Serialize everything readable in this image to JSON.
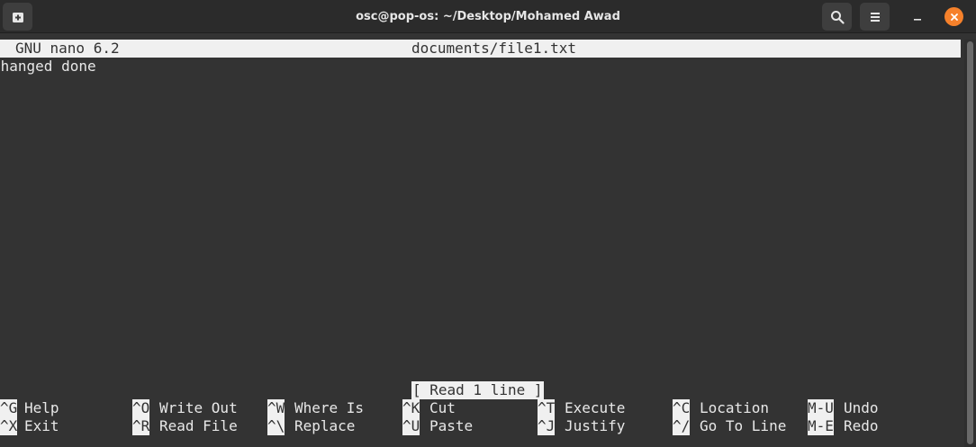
{
  "window": {
    "title": "osc@pop-os: ~/Desktop/Mohamed Awad"
  },
  "titlebar_icons": {
    "new_tab": "new-tab-icon",
    "search": "search-icon",
    "menu": "hamburger-menu-icon",
    "minimize": "minimize-icon",
    "close": "close-icon",
    "close_color": "#f6812b"
  },
  "nano": {
    "version": "GNU nano 6.2",
    "filename": "documents/file1.txt",
    "content": [
      "changed done"
    ],
    "status": "[ Read 1 line ]"
  },
  "shortcuts": [
    {
      "key": "^G",
      "label": "Help"
    },
    {
      "key": "^O",
      "label": "Write Out"
    },
    {
      "key": "^W",
      "label": "Where Is"
    },
    {
      "key": "^K",
      "label": "Cut"
    },
    {
      "key": "^T",
      "label": "Execute"
    },
    {
      "key": "^C",
      "label": "Location"
    },
    {
      "key": "M-U",
      "label": "Undo"
    },
    {
      "key": "^X",
      "label": "Exit"
    },
    {
      "key": "^R",
      "label": "Read File"
    },
    {
      "key": "^\\",
      "label": "Replace"
    },
    {
      "key": "^U",
      "label": "Paste"
    },
    {
      "key": "^J",
      "label": "Justify"
    },
    {
      "key": "^/",
      "label": "Go To Line"
    },
    {
      "key": "M-E",
      "label": "Redo"
    }
  ]
}
